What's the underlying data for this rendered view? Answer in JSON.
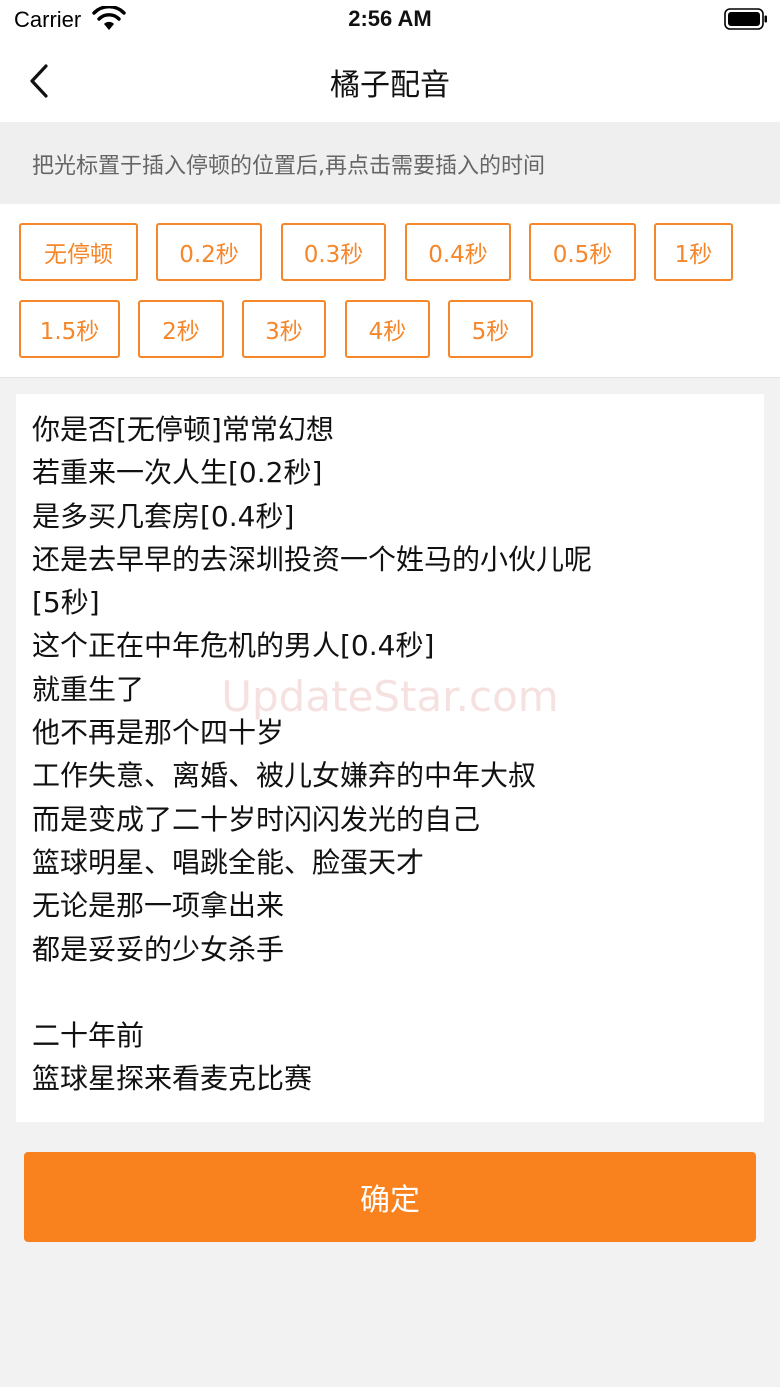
{
  "status_bar": {
    "carrier": "Carrier",
    "time": "2:56 AM",
    "wifi_icon": "wifi-icon",
    "battery_icon": "battery-full-icon"
  },
  "nav": {
    "title": "橘子配音",
    "back_icon": "chevron-left-icon"
  },
  "hint": {
    "text": "把光标置于插入停顿的位置后,再点击需要插入的时间"
  },
  "pause_options": [
    "无停顿",
    "0.2秒",
    "0.3秒",
    "0.4秒",
    "0.5秒",
    "1秒",
    "1.5秒",
    "2秒",
    "3秒",
    "4秒",
    "5秒"
  ],
  "editor": {
    "lines": [
      "你是否[无停顿]常常幻想",
      "若重来一次人生[0.2秒]",
      "是多买几套房[0.4秒]",
      "还是去早早的去深圳投资一个姓马的小伙儿呢",
      "[5秒]",
      "这个正在中年危机的男人[0.4秒]",
      "就重生了",
      "他不再是那个四十岁",
      "工作失意、离婚、被儿女嫌弃的中年大叔",
      "而是变成了二十岁时闪闪发光的自己",
      "篮球明星、唱跳全能、脸蛋天才",
      "无论是那一项拿出来",
      "都是妥妥的少女杀手",
      "",
      "二十年前",
      "篮球星探来看麦克比赛"
    ]
  },
  "watermark": "UpdateStar.com",
  "confirm_label": "确定",
  "colors": {
    "accent": "#f9821e",
    "button_outline": "#f5862a",
    "background": "#f2f2f2"
  }
}
